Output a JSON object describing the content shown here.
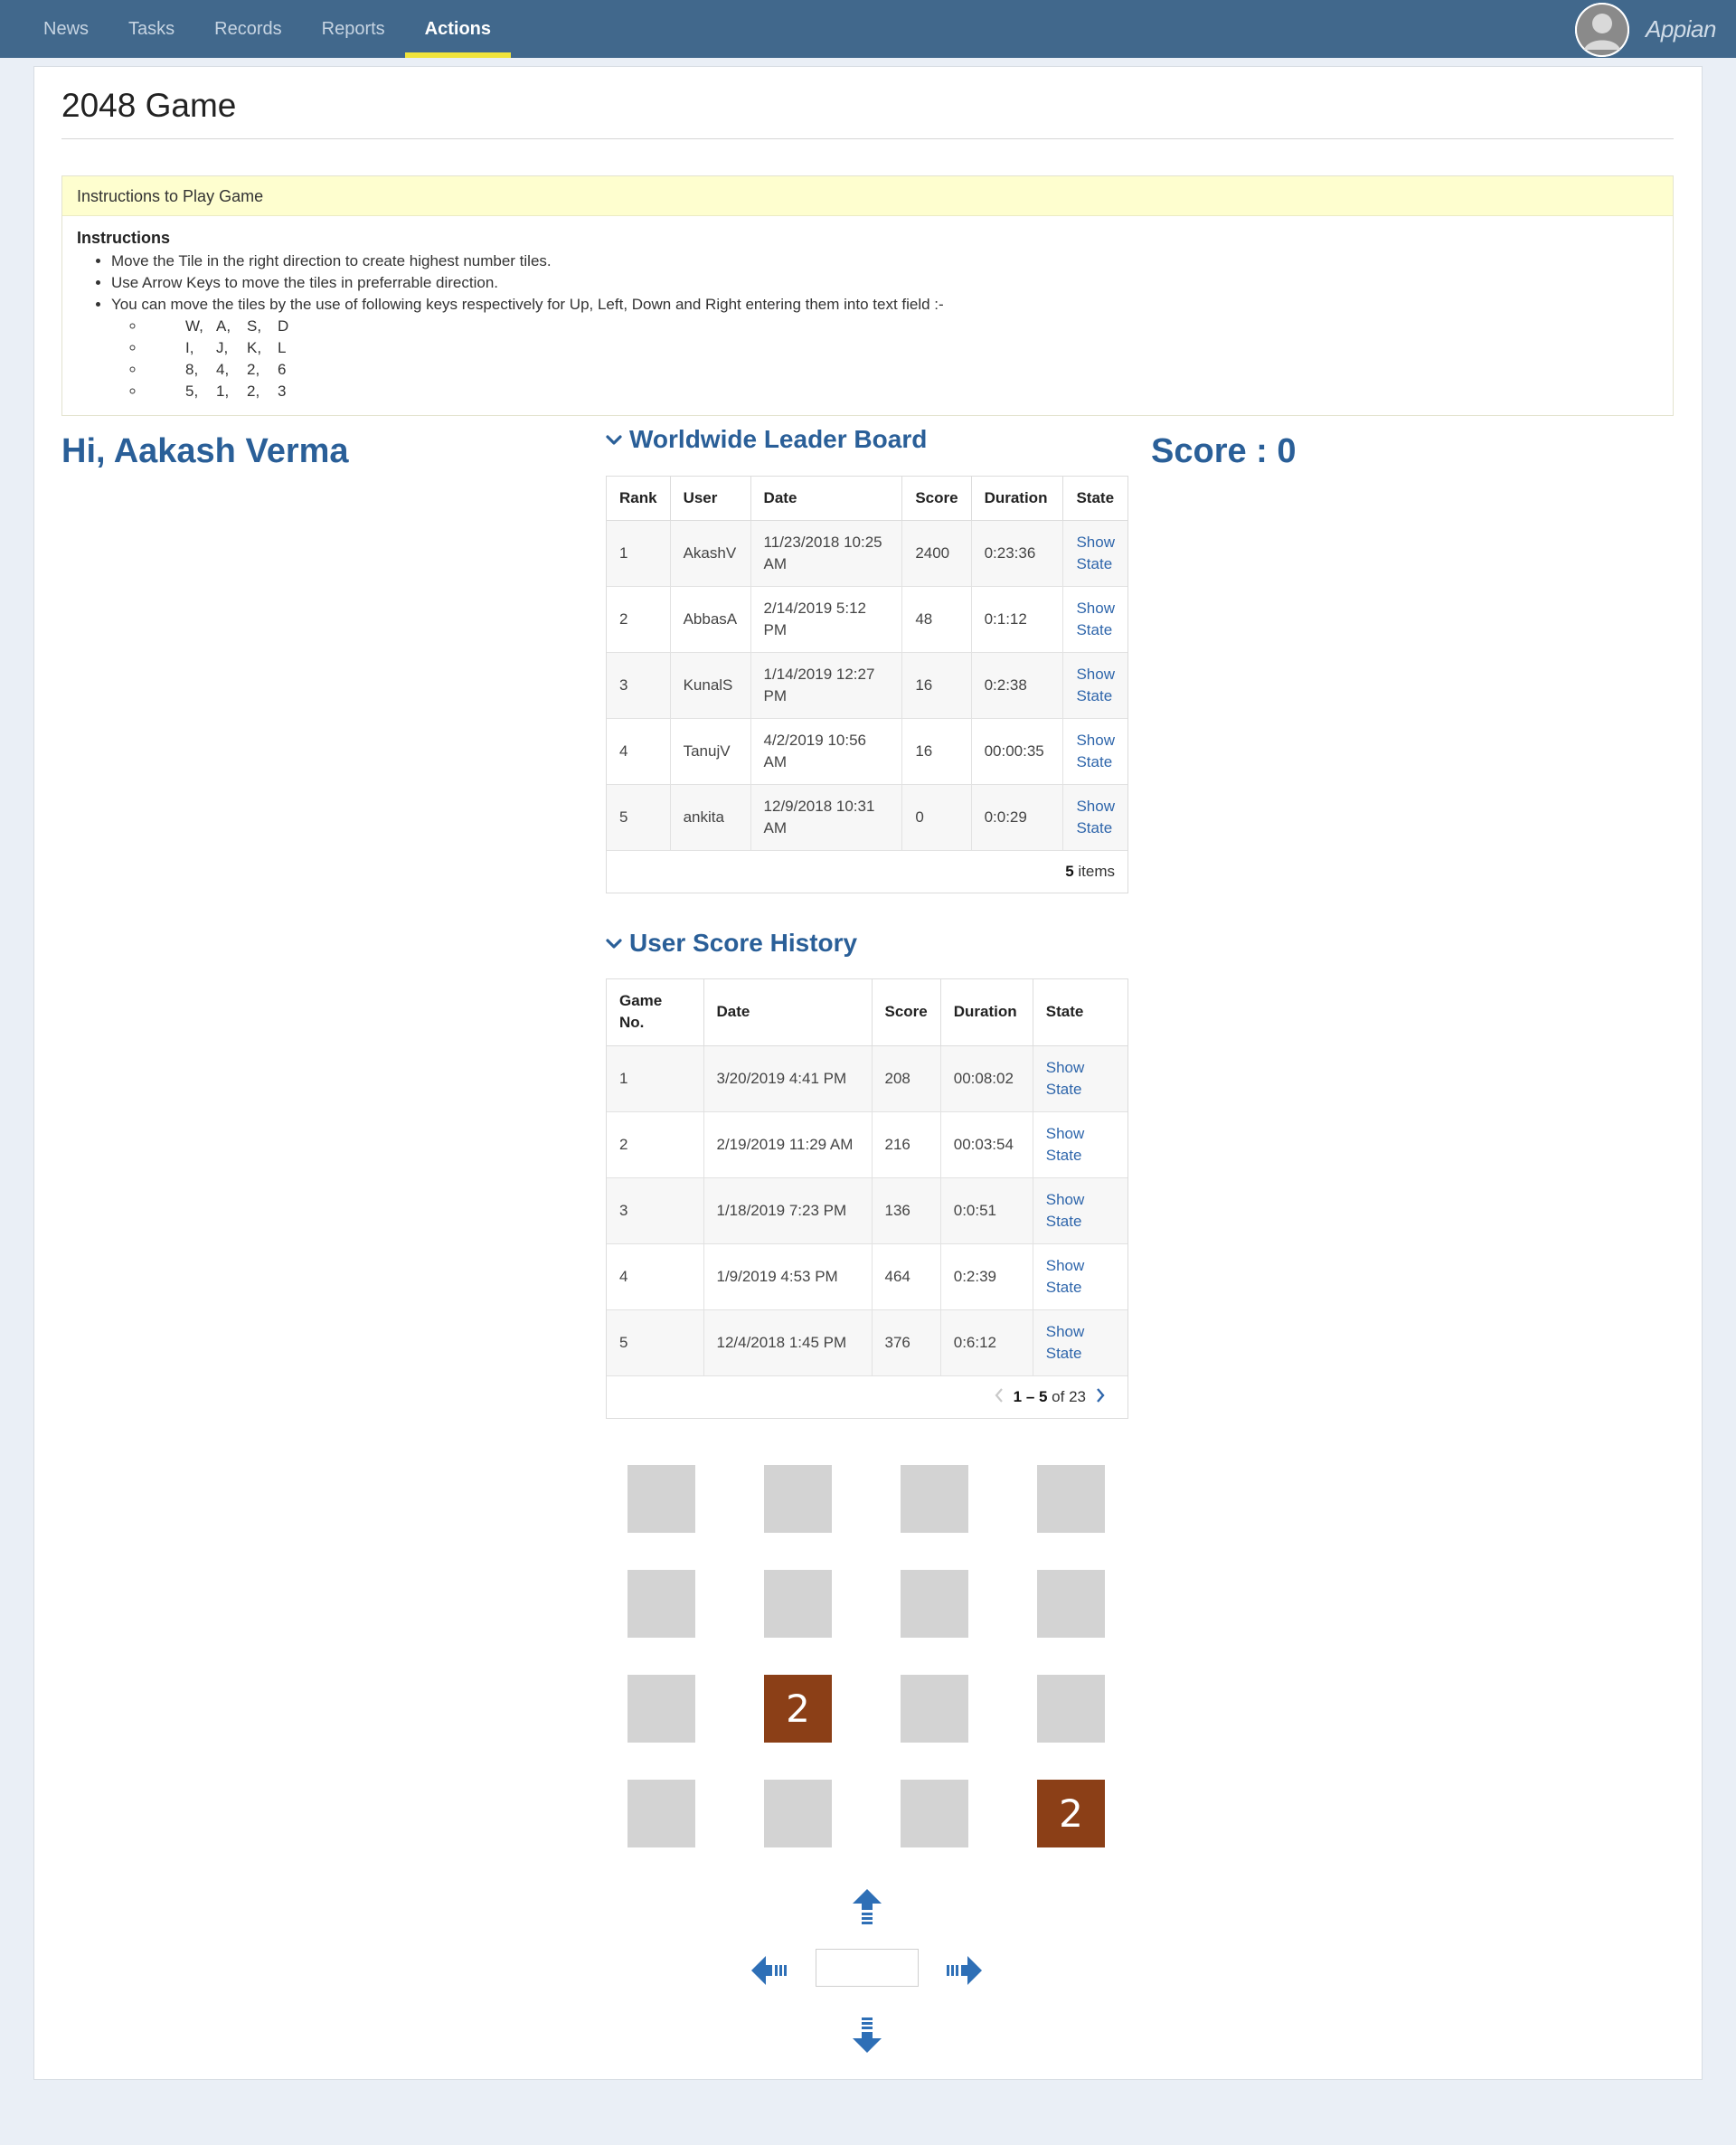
{
  "nav": {
    "items": [
      {
        "label": "News"
      },
      {
        "label": "Tasks"
      },
      {
        "label": "Records"
      },
      {
        "label": "Reports"
      },
      {
        "label": "Actions",
        "active": true
      }
    ],
    "brand": "Appian"
  },
  "page": {
    "title": "2048 Game"
  },
  "instructions": {
    "header": "Instructions to Play Game",
    "heading": "Instructions",
    "bullets": [
      "Move the Tile in the right direction to create highest number tiles.",
      "Use Arrow Keys to move the tiles in preferrable direction.",
      "You can move the tiles by the use of following keys respectively for Up, Left, Down and Right entering them into text field :-"
    ],
    "key_sets": [
      [
        "W,",
        "A,",
        "S,",
        "D"
      ],
      [
        "I,",
        "J,",
        "K,",
        "L"
      ],
      [
        "8,",
        "4,",
        "2,",
        "6"
      ],
      [
        "5,",
        "1,",
        "2,",
        "3"
      ]
    ]
  },
  "greeting": "Hi, Aakash Verma",
  "score_text": "Score : 0",
  "leaderboard": {
    "title": "Worldwide Leader Board",
    "columns": [
      "Rank",
      "User",
      "Date",
      "Score",
      "Duration",
      "State"
    ],
    "rows": [
      {
        "rank": "1",
        "user": "AkashV",
        "date": "11/23/2018 10:25 AM",
        "score": "2400",
        "duration": "0:23:36",
        "state": "Show State"
      },
      {
        "rank": "2",
        "user": "AbbasA",
        "date": "2/14/2019 5:12 PM",
        "score": "48",
        "duration": "0:1:12",
        "state": "Show State"
      },
      {
        "rank": "3",
        "user": "KunalS",
        "date": "1/14/2019 12:27 PM",
        "score": "16",
        "duration": "0:2:38",
        "state": "Show State"
      },
      {
        "rank": "4",
        "user": "TanujV",
        "date": "4/2/2019 10:56 AM",
        "score": "16",
        "duration": "00:00:35",
        "state": "Show State"
      },
      {
        "rank": "5",
        "user": "ankita",
        "date": "12/9/2018 10:31 AM",
        "score": "0",
        "duration": "0:0:29",
        "state": "Show State"
      }
    ],
    "footer_count": "5",
    "footer_label": " items"
  },
  "history": {
    "title": "User Score History",
    "columns": [
      "Game No.",
      "Date",
      "Score",
      "Duration",
      "State"
    ],
    "rows": [
      {
        "game": "1",
        "date": "3/20/2019 4:41 PM",
        "score": "208",
        "duration": "00:08:02",
        "state": "Show State"
      },
      {
        "game": "2",
        "date": "2/19/2019 11:29 AM",
        "score": "216",
        "duration": "00:03:54",
        "state": "Show State"
      },
      {
        "game": "3",
        "date": "1/18/2019 7:23 PM",
        "score": "136",
        "duration": "0:0:51",
        "state": "Show State"
      },
      {
        "game": "4",
        "date": "1/9/2019 4:53 PM",
        "score": "464",
        "duration": "0:2:39",
        "state": "Show State"
      },
      {
        "game": "5",
        "date": "12/4/2018 1:45 PM",
        "score": "376",
        "duration": "0:6:12",
        "state": "Show State"
      }
    ],
    "pager_range": "1 – 5",
    "pager_of": " of 23"
  },
  "board": {
    "tiles": [
      [
        "",
        "",
        "",
        ""
      ],
      [
        "",
        "",
        "",
        ""
      ],
      [
        "",
        "2",
        "",
        ""
      ],
      [
        "",
        "",
        "",
        "2"
      ]
    ],
    "empty_color": "#d3d3d3",
    "filled_color": "#8b3f17"
  },
  "colors": {
    "topbar": "#41688c",
    "accent": "#2a5f98",
    "active_tab_underline": "#f1e43b",
    "arrow": "#2e6fb6"
  },
  "controls": {
    "input_value": "",
    "icons": [
      "arrow-up-icon",
      "arrow-left-icon",
      "arrow-right-icon",
      "arrow-down-icon"
    ]
  }
}
